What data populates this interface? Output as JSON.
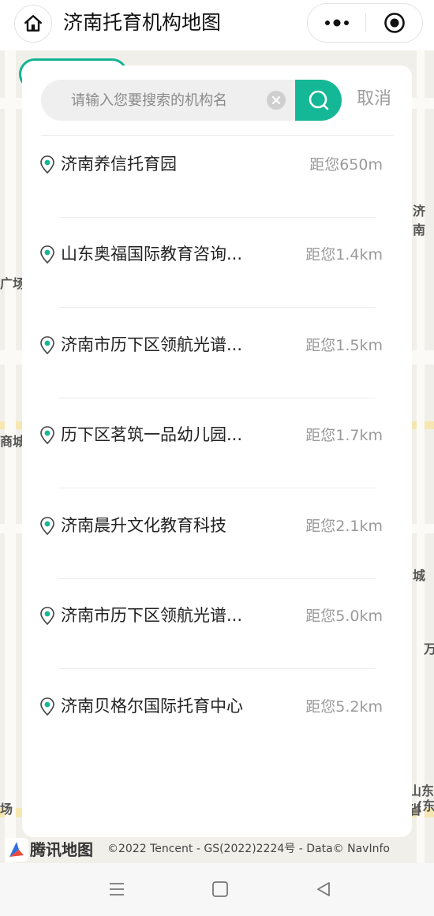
{
  "header": {
    "title": "济南托育机构地图",
    "home_icon": "home-icon",
    "more_icon": "more-dots-icon",
    "close_icon": "target-close-icon"
  },
  "search": {
    "placeholder": "请输入您要搜索的机构名",
    "value": "",
    "cancel_label": "取消",
    "accent_color": "#15b896"
  },
  "results": [
    {
      "name": "济南养信托育园",
      "distance": "距您650m"
    },
    {
      "name": "山东奥福国际教育咨询...",
      "distance": "距您1.4km"
    },
    {
      "name": "济南市历下区领航光谱...",
      "distance": "距您1.5km"
    },
    {
      "name": "历下区茗筑一品幼儿园...",
      "distance": "距您1.7km"
    },
    {
      "name": "济南晨升文化教育科技",
      "distance": "距您2.1km"
    },
    {
      "name": "济南市历下区领航光谱...",
      "distance": "距您5.0km"
    },
    {
      "name": "济南贝格尔国际托育中心",
      "distance": "距您5.2km"
    }
  ],
  "map": {
    "brand": "腾讯地图",
    "copyright": "©2022 Tencent - GS(2022)2224号 - Data© NavInfo",
    "labels": [
      "广场",
      "商城",
      "济南",
      "城",
      "万",
      "山东省",
      "(东",
      "场"
    ]
  },
  "navbar": {
    "menu_icon": "menu-icon",
    "home_icon": "square-home-icon",
    "back_icon": "triangle-back-icon"
  }
}
